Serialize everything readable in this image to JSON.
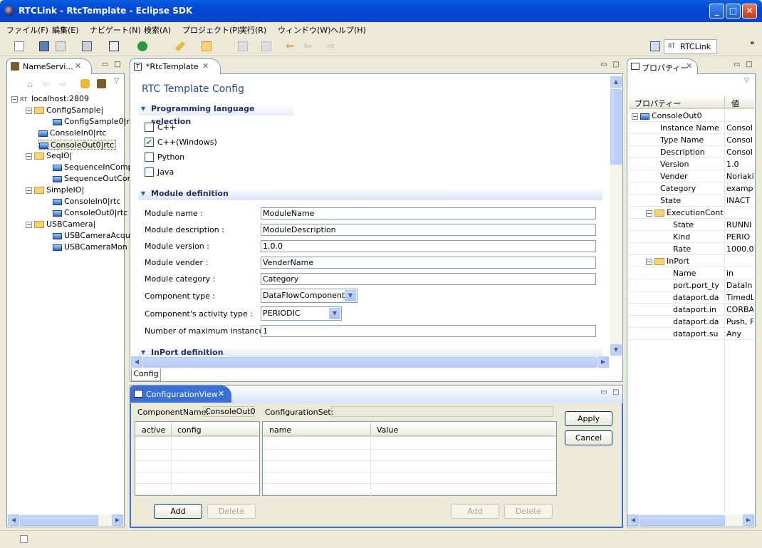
{
  "window": {
    "title": "RTCLink - RtcTemplate - Eclipse SDK"
  },
  "menu": [
    "ファイル(F)",
    "編集(E)",
    "ナビゲート(N)",
    "検索(A)",
    "プロジェクト(P)",
    "実行(R)",
    "ウィンドウ(W)",
    "ヘルプ(H)"
  ],
  "perspective": {
    "label": "RTCLink",
    "rt": "RT"
  },
  "nameservice": {
    "tab": "NameServi...",
    "root": "localhost:2809",
    "root_rt": "RT",
    "items": [
      "ConfigSample|",
      "ConfigSample0|r",
      "ConsoleIn0|rtc",
      "ConsoleOut0|rtc",
      "SeqIO|",
      "SequenceInComp",
      "SequenceOutCor",
      "SimpleIO|",
      "ConsoleIn0|rtc",
      "ConsoleOut0|rtc",
      "USBCamera|",
      "USBCameraAcqu",
      "USBCameraMon"
    ]
  },
  "editor": {
    "tab": "*RtcTemplate",
    "title": "RTC Template Config",
    "lang_section": "Programming language selection",
    "languages": [
      {
        "label": "C++",
        "checked": false
      },
      {
        "label": "C++(Windows)",
        "checked": true
      },
      {
        "label": "Python",
        "checked": false
      },
      {
        "label": "Java",
        "checked": false
      }
    ],
    "module_section": "Module definition",
    "fields": [
      {
        "label": "Module name :",
        "value": "ModuleName"
      },
      {
        "label": "Module description :",
        "value": "ModuleDescription"
      },
      {
        "label": "Module version :",
        "value": "1.0.0"
      },
      {
        "label": "Module vender :",
        "value": "VenderName"
      },
      {
        "label": "Module category :",
        "value": "Category"
      }
    ],
    "component_type_label": "Component type :",
    "component_type_value": "DataFlowComponent",
    "activity_type_label": "Component's activity type :",
    "activity_type_value": "PERIODIC",
    "max_instance_label": "Number of maximum instance :",
    "max_instance_value": "1",
    "inport_section": "InPort definition",
    "bottom_tab": "Config"
  },
  "configview": {
    "tab": "ConfigurationView",
    "component_label": "ComponentName:",
    "component_value": "ConsoleOut0",
    "configset_label": "ConfigurationSet:",
    "configset_value": "",
    "left_headers": [
      "active",
      "config"
    ],
    "right_headers": [
      "name",
      "Value"
    ],
    "apply": "Apply",
    "cancel": "Cancel",
    "add1": "Add",
    "delete1": "Delete",
    "add2": "Add",
    "delete2": "Delete"
  },
  "properties": {
    "tab": "プロパティー",
    "header_prop": "プロパティー",
    "header_val": "値",
    "rows": [
      {
        "name": "ConsoleOut0",
        "value": "",
        "level": 0,
        "group": true
      },
      {
        "name": "Instance Name",
        "value": "Consol",
        "level": 2
      },
      {
        "name": "Type Name",
        "value": "Consol",
        "level": 2
      },
      {
        "name": "Description",
        "value": "Consol",
        "level": 2
      },
      {
        "name": "Version",
        "value": "1.0",
        "level": 2
      },
      {
        "name": "Vender",
        "value": "Noriaki",
        "level": 2
      },
      {
        "name": "Category",
        "value": "exampl",
        "level": 2
      },
      {
        "name": "State",
        "value": "INACT",
        "level": 2
      },
      {
        "name": "ExecutionCont",
        "value": "",
        "level": 1,
        "group": true
      },
      {
        "name": "State",
        "value": "RUNNI",
        "level": 3
      },
      {
        "name": "Kind",
        "value": "PERIO",
        "level": 3
      },
      {
        "name": "Rate",
        "value": "1000.0",
        "level": 3
      },
      {
        "name": "InPort",
        "value": "",
        "level": 1,
        "group": true
      },
      {
        "name": "Name",
        "value": "in",
        "level": 3
      },
      {
        "name": "port.port_ty",
        "value": "DataIn",
        "level": 3
      },
      {
        "name": "dataport.da",
        "value": "TimedL",
        "level": 3
      },
      {
        "name": "dataport.in",
        "value": "CORBA",
        "level": 3
      },
      {
        "name": "dataport.da",
        "value": "Push, F",
        "level": 3
      },
      {
        "name": "dataport.su",
        "value": "Any",
        "level": 3
      }
    ]
  },
  "colors": {
    "titlebar": "#0046d5",
    "accent": "#3156a0",
    "frame": "#ece9d8"
  }
}
